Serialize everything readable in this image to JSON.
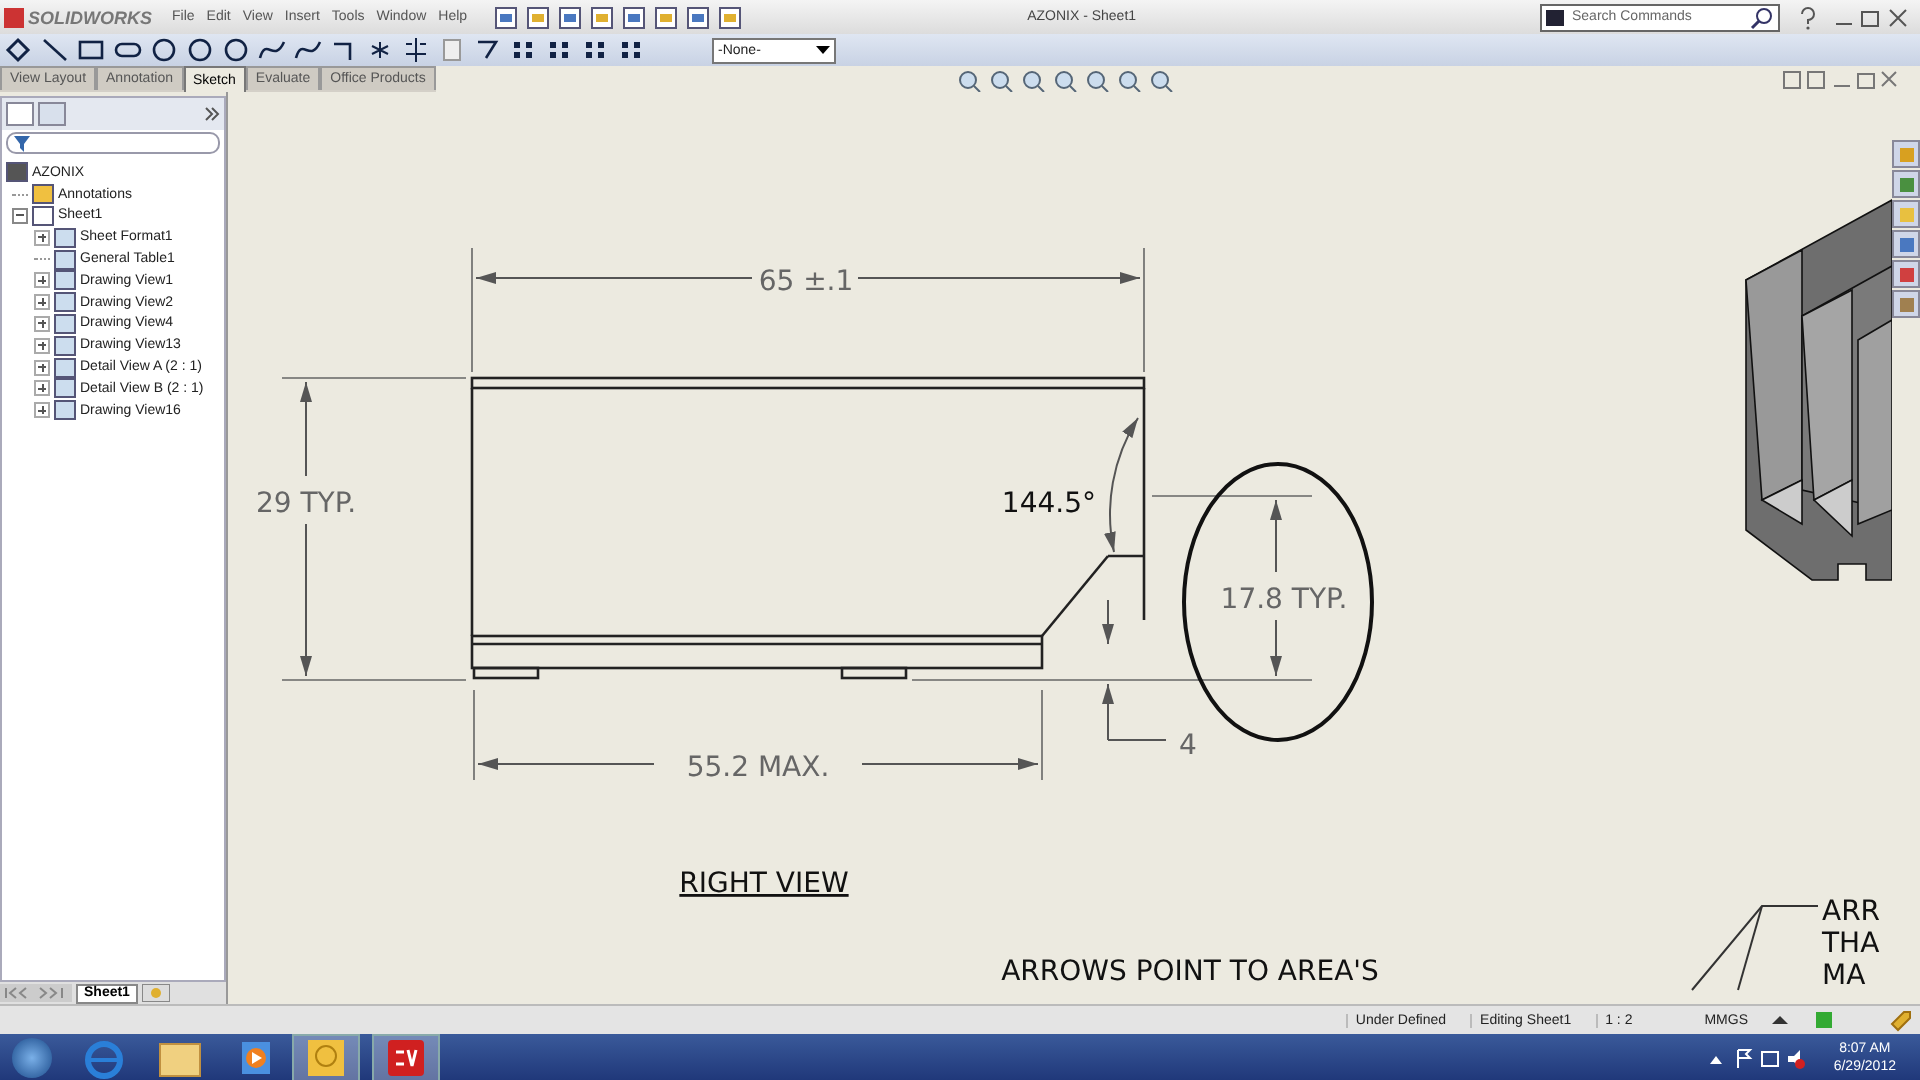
{
  "app": {
    "logo": "SOLIDWORKS",
    "menu": [
      "File",
      "Edit",
      "View",
      "Insert",
      "Tools",
      "Window",
      "Help"
    ],
    "title": "AZONIX - Sheet1",
    "search": {
      "placeholder": "Search Commands"
    }
  },
  "toolbar": {
    "layer_dropdown": "-None-"
  },
  "tabs": [
    {
      "label": "View Layout",
      "selected": false
    },
    {
      "label": "Annotation",
      "selected": false
    },
    {
      "label": "Sketch",
      "selected": true
    },
    {
      "label": "Evaluate",
      "selected": false
    },
    {
      "label": "Office Products",
      "selected": false
    }
  ],
  "tree": {
    "label": "AZONIX",
    "children": [
      {
        "label": "Annotations"
      },
      {
        "label": "Sheet1",
        "expanded": true,
        "children": [
          {
            "label": "Sheet Format1",
            "expanded": false
          },
          {
            "label": "General Table1"
          },
          {
            "label": "Drawing View1",
            "expanded": false
          },
          {
            "label": "Drawing View2",
            "expanded": false
          },
          {
            "label": "Drawing View4",
            "expanded": false
          },
          {
            "label": "Drawing View13",
            "expanded": false
          },
          {
            "label": "Detail View A (2 : 1)",
            "expanded": false
          },
          {
            "label": "Detail View B (2 : 1)",
            "expanded": false
          },
          {
            "label": "Drawing View16",
            "expanded": false
          }
        ]
      }
    ]
  },
  "drawing": {
    "width_dim": "65 ±.1",
    "height_dim": "29 TYP.",
    "angle_dim": "144.5°",
    "fin_dim": "17.8 TYP.",
    "step_dim": "4",
    "length_dim": "55.2 MAX.",
    "view_label": "RIGHT VIEW",
    "note": "ARROWS POINT TO AREA'S",
    "side_note": [
      "ARR",
      "THA",
      "MA"
    ]
  },
  "sheet_tabs": [
    {
      "label": "Sheet1",
      "selected": true
    }
  ],
  "status_bar": {
    "state": "Under Defined",
    "editing": "Editing Sheet1",
    "scale": "1 : 2",
    "units": "MMGS"
  },
  "taskbar": {
    "time": "8:07 AM",
    "date": "6/29/2012"
  }
}
